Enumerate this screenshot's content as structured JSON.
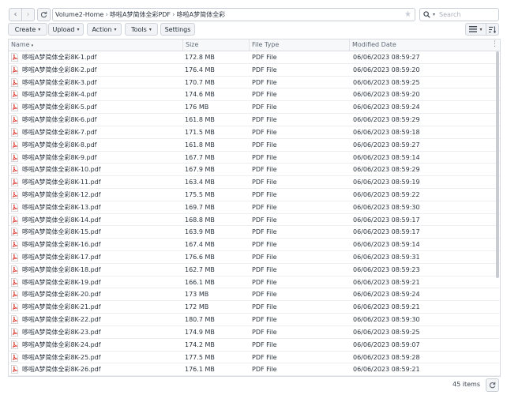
{
  "nav": {
    "back_glyph": "‹",
    "forward_glyph": "›",
    "breadcrumbs": [
      "Volume2-Home",
      "哆啦A梦简体全彩PDF",
      "哆啦A梦简体全彩"
    ],
    "search_placeholder": "Search"
  },
  "toolbar": {
    "create": "Create",
    "upload": "Upload",
    "action": "Action",
    "tools": "Tools",
    "settings": "Settings"
  },
  "columns": [
    "Name",
    "Size",
    "File Type",
    "Modified Date"
  ],
  "files": [
    {
      "name": "哆啦A梦简体全彩8K-1.pdf",
      "size": "172.8 MB",
      "type": "PDF File",
      "modified": "06/06/2023 08:59:27"
    },
    {
      "name": "哆啦A梦简体全彩8K-2.pdf",
      "size": "176.4 MB",
      "type": "PDF File",
      "modified": "06/06/2023 08:59:20"
    },
    {
      "name": "哆啦A梦简体全彩8K-3.pdf",
      "size": "170.7 MB",
      "type": "PDF File",
      "modified": "06/06/2023 08:59:25"
    },
    {
      "name": "哆啦A梦简体全彩8K-4.pdf",
      "size": "174.6 MB",
      "type": "PDF File",
      "modified": "06/06/2023 08:59:20"
    },
    {
      "name": "哆啦A梦简体全彩8K-5.pdf",
      "size": "176 MB",
      "type": "PDF File",
      "modified": "06/06/2023 08:59:24"
    },
    {
      "name": "哆啦A梦简体全彩8K-6.pdf",
      "size": "161.8 MB",
      "type": "PDF File",
      "modified": "06/06/2023 08:59:29"
    },
    {
      "name": "哆啦A梦简体全彩8K-7.pdf",
      "size": "171.5 MB",
      "type": "PDF File",
      "modified": "06/06/2023 08:59:18"
    },
    {
      "name": "哆啦A梦简体全彩8K-8.pdf",
      "size": "161.8 MB",
      "type": "PDF File",
      "modified": "06/06/2023 08:59:27"
    },
    {
      "name": "哆啦A梦简体全彩8K-9.pdf",
      "size": "167.7 MB",
      "type": "PDF File",
      "modified": "06/06/2023 08:59:14"
    },
    {
      "name": "哆啦A梦简体全彩8K-10.pdf",
      "size": "167.9 MB",
      "type": "PDF File",
      "modified": "06/06/2023 08:59:29"
    },
    {
      "name": "哆啦A梦简体全彩8K-11.pdf",
      "size": "163.4 MB",
      "type": "PDF File",
      "modified": "06/06/2023 08:59:19"
    },
    {
      "name": "哆啦A梦简体全彩8K-12.pdf",
      "size": "175.5 MB",
      "type": "PDF File",
      "modified": "06/06/2023 08:59:22"
    },
    {
      "name": "哆啦A梦简体全彩8K-13.pdf",
      "size": "169.7 MB",
      "type": "PDF File",
      "modified": "06/06/2023 08:59:30"
    },
    {
      "name": "哆啦A梦简体全彩8K-14.pdf",
      "size": "168.8 MB",
      "type": "PDF File",
      "modified": "06/06/2023 08:59:17"
    },
    {
      "name": "哆啦A梦简体全彩8K-15.pdf",
      "size": "163.9 MB",
      "type": "PDF File",
      "modified": "06/06/2023 08:59:17"
    },
    {
      "name": "哆啦A梦简体全彩8K-16.pdf",
      "size": "167.4 MB",
      "type": "PDF File",
      "modified": "06/06/2023 08:59:14"
    },
    {
      "name": "哆啦A梦简体全彩8K-17.pdf",
      "size": "176.6 MB",
      "type": "PDF File",
      "modified": "06/06/2023 08:59:31"
    },
    {
      "name": "哆啦A梦简体全彩8K-18.pdf",
      "size": "162.7 MB",
      "type": "PDF File",
      "modified": "06/06/2023 08:59:23"
    },
    {
      "name": "哆啦A梦简体全彩8K-19.pdf",
      "size": "166.1 MB",
      "type": "PDF File",
      "modified": "06/06/2023 08:59:21"
    },
    {
      "name": "哆啦A梦简体全彩8K-20.pdf",
      "size": "173 MB",
      "type": "PDF File",
      "modified": "06/06/2023 08:59:24"
    },
    {
      "name": "哆啦A梦简体全彩8K-21.pdf",
      "size": "172 MB",
      "type": "PDF File",
      "modified": "06/06/2023 08:59:21"
    },
    {
      "name": "哆啦A梦简体全彩8K-22.pdf",
      "size": "180.7 MB",
      "type": "PDF File",
      "modified": "06/06/2023 08:59:30"
    },
    {
      "name": "哆啦A梦简体全彩8K-23.pdf",
      "size": "174.9 MB",
      "type": "PDF File",
      "modified": "06/06/2023 08:59:25"
    },
    {
      "name": "哆啦A梦简体全彩8K-24.pdf",
      "size": "174.2 MB",
      "type": "PDF File",
      "modified": "06/06/2023 08:59:07"
    },
    {
      "name": "哆啦A梦简体全彩8K-25.pdf",
      "size": "177.5 MB",
      "type": "PDF File",
      "modified": "06/06/2023 08:59:28"
    },
    {
      "name": "哆啦A梦简体全彩8K-26.pdf",
      "size": "176.1 MB",
      "type": "PDF File",
      "modified": "06/06/2023 08:59:21"
    }
  ],
  "footer": {
    "item_count": "45 items"
  },
  "colors": {
    "pdf_icon": "#d9342b",
    "border": "#c9ced6",
    "button_bg": "#f1f3f6"
  },
  "icons": {
    "refresh": "refresh-icon",
    "search": "search-icon",
    "star": "star-icon",
    "list_view": "list-view-icon",
    "sort": "sort-icon",
    "file": "pdf-file-icon"
  }
}
